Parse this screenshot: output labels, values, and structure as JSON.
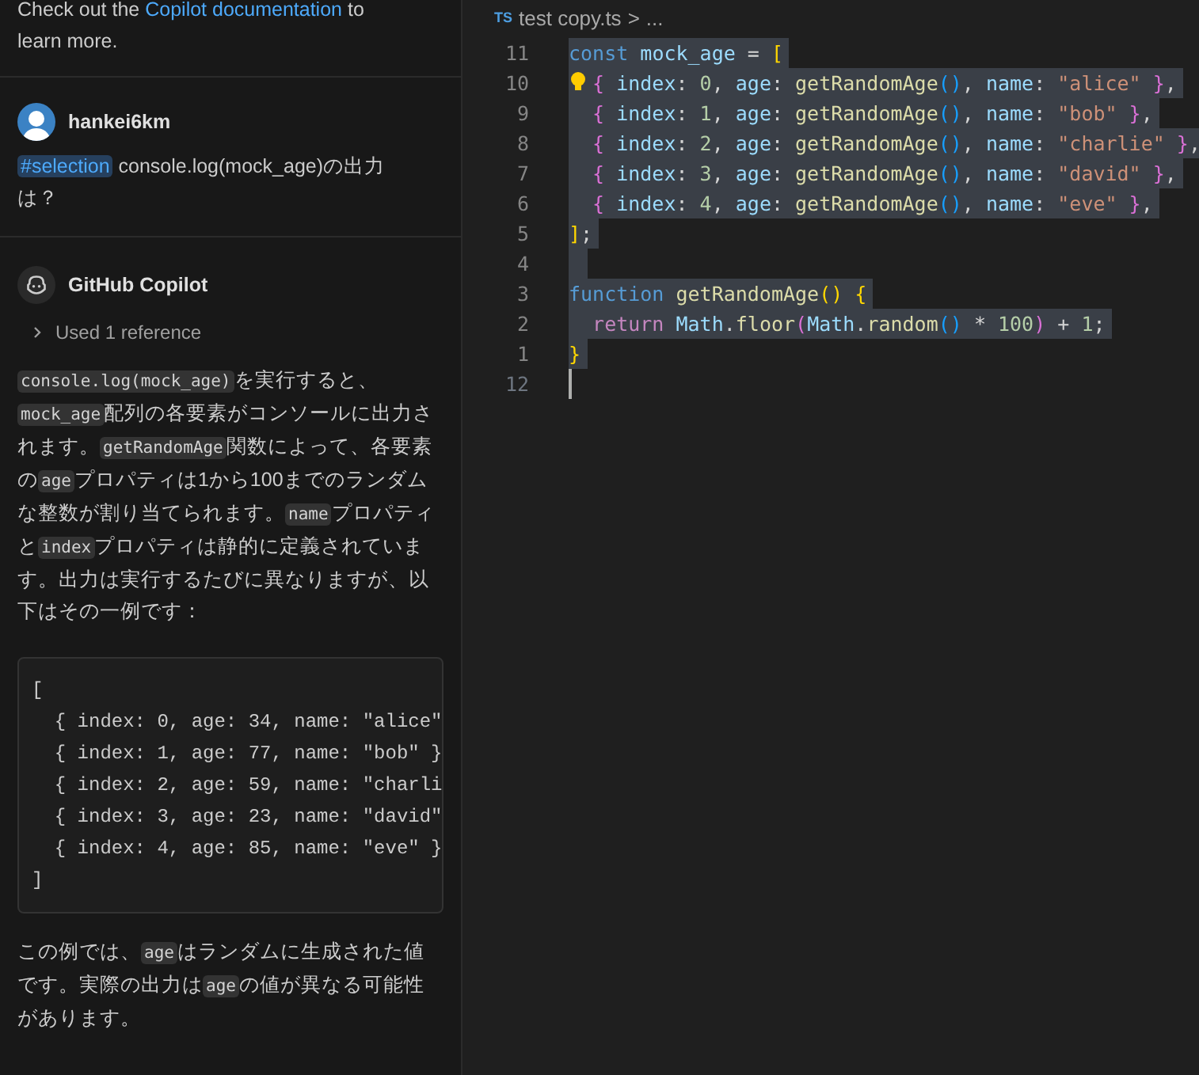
{
  "chat": {
    "intro": [
      {
        "kind": "text",
        "text": "Check out the "
      },
      {
        "kind": "link",
        "text": "Copilot documentation"
      },
      {
        "kind": "text",
        "text": " to learn more."
      }
    ],
    "question": {
      "user": "hankei6km",
      "tag": "#selection",
      "text": " console.log(mock_age)の出力は？"
    },
    "answer": {
      "author": "GitHub Copilot",
      "references": "Used 1 reference",
      "expanded": false,
      "paragraph_1": [
        {
          "kind": "code",
          "text": "console.log(mock_age)"
        },
        {
          "kind": "text",
          "text": "を実行すると、"
        },
        {
          "kind": "code",
          "text": "mock_age"
        },
        {
          "kind": "text",
          "text": "配列の各要素がコンソールに出力されます。"
        },
        {
          "kind": "code",
          "text": "getRandomAge"
        },
        {
          "kind": "text",
          "text": "関数によって、各要素の"
        },
        {
          "kind": "code",
          "text": "age"
        },
        {
          "kind": "text",
          "text": "プロパティは1から100までのランダムな整数が割り当てられます。"
        },
        {
          "kind": "code",
          "text": "name"
        },
        {
          "kind": "text",
          "text": "プロパティと"
        },
        {
          "kind": "code",
          "text": "index"
        },
        {
          "kind": "text",
          "text": "プロパティは静的に定義されています。出力は実行するたびに異なりますが、以下はその一例です："
        }
      ],
      "code_block": [
        "[",
        "  { index: 0, age: 34, name: \"alice\"",
        "  { index: 1, age: 77, name: \"bob\" }",
        "  { index: 2, age: 59, name: \"charli",
        "  { index: 3, age: 23, name: \"david\"",
        "  { index: 4, age: 85, name: \"eve\" }",
        "]"
      ],
      "paragraph_2": [
        {
          "kind": "text",
          "text": "この例では、"
        },
        {
          "kind": "code",
          "text": "age"
        },
        {
          "kind": "text",
          "text": "はランダムに生成された値です。実際の出力は"
        },
        {
          "kind": "code",
          "text": "age"
        },
        {
          "kind": "text",
          "text": "の値が異なる可能性があります。"
        }
      ]
    }
  },
  "editor": {
    "breadcrumb": {
      "icon": "TS",
      "file": "test copy.ts",
      "separator": ">",
      "rest": "..."
    },
    "lines": [
      {
        "number": "11",
        "selected": true,
        "current": false,
        "lightbulb": false,
        "tokens": [
          {
            "kind": "keyword",
            "text": "const"
          },
          {
            "kind": "variable",
            "text": " mock_age"
          },
          {
            "kind": "plain",
            "text": " = "
          },
          {
            "kind": "bracket1",
            "text": "["
          }
        ]
      },
      {
        "number": "10",
        "selected": true,
        "current": false,
        "lightbulb": true,
        "tokens": [
          {
            "kind": "bracket2",
            "text": "  {"
          },
          {
            "kind": "variable",
            "text": " index"
          },
          {
            "kind": "plain",
            "text": ": "
          },
          {
            "kind": "number",
            "text": "0"
          },
          {
            "kind": "plain",
            "text": ", "
          },
          {
            "kind": "variable",
            "text": "age"
          },
          {
            "kind": "plain",
            "text": ": "
          },
          {
            "kind": "function",
            "text": "getRandomAge"
          },
          {
            "kind": "bracket3",
            "text": "()"
          },
          {
            "kind": "plain",
            "text": ", "
          },
          {
            "kind": "variable",
            "text": "name"
          },
          {
            "kind": "plain",
            "text": ": "
          },
          {
            "kind": "string",
            "text": "\"alice\""
          },
          {
            "kind": "bracket2",
            "text": " }"
          },
          {
            "kind": "plain",
            "text": ","
          }
        ]
      },
      {
        "number": "9",
        "selected": true,
        "current": false,
        "lightbulb": false,
        "tokens": [
          {
            "kind": "bracket2",
            "text": "  {"
          },
          {
            "kind": "variable",
            "text": " index"
          },
          {
            "kind": "plain",
            "text": ": "
          },
          {
            "kind": "number",
            "text": "1"
          },
          {
            "kind": "plain",
            "text": ", "
          },
          {
            "kind": "variable",
            "text": "age"
          },
          {
            "kind": "plain",
            "text": ": "
          },
          {
            "kind": "function",
            "text": "getRandomAge"
          },
          {
            "kind": "bracket3",
            "text": "()"
          },
          {
            "kind": "plain",
            "text": ", "
          },
          {
            "kind": "variable",
            "text": "name"
          },
          {
            "kind": "plain",
            "text": ": "
          },
          {
            "kind": "string",
            "text": "\"bob\""
          },
          {
            "kind": "bracket2",
            "text": " }"
          },
          {
            "kind": "plain",
            "text": ","
          }
        ]
      },
      {
        "number": "8",
        "selected": true,
        "current": false,
        "lightbulb": false,
        "tokens": [
          {
            "kind": "bracket2",
            "text": "  {"
          },
          {
            "kind": "variable",
            "text": " index"
          },
          {
            "kind": "plain",
            "text": ": "
          },
          {
            "kind": "number",
            "text": "2"
          },
          {
            "kind": "plain",
            "text": ", "
          },
          {
            "kind": "variable",
            "text": "age"
          },
          {
            "kind": "plain",
            "text": ": "
          },
          {
            "kind": "function",
            "text": "getRandomAge"
          },
          {
            "kind": "bracket3",
            "text": "()"
          },
          {
            "kind": "plain",
            "text": ", "
          },
          {
            "kind": "variable",
            "text": "name"
          },
          {
            "kind": "plain",
            "text": ": "
          },
          {
            "kind": "string",
            "text": "\"charlie\""
          },
          {
            "kind": "bracket2",
            "text": " }"
          },
          {
            "kind": "plain",
            "text": ","
          }
        ]
      },
      {
        "number": "7",
        "selected": true,
        "current": false,
        "lightbulb": false,
        "tokens": [
          {
            "kind": "bracket2",
            "text": "  {"
          },
          {
            "kind": "variable",
            "text": " index"
          },
          {
            "kind": "plain",
            "text": ": "
          },
          {
            "kind": "number",
            "text": "3"
          },
          {
            "kind": "plain",
            "text": ", "
          },
          {
            "kind": "variable",
            "text": "age"
          },
          {
            "kind": "plain",
            "text": ": "
          },
          {
            "kind": "function",
            "text": "getRandomAge"
          },
          {
            "kind": "bracket3",
            "text": "()"
          },
          {
            "kind": "plain",
            "text": ", "
          },
          {
            "kind": "variable",
            "text": "name"
          },
          {
            "kind": "plain",
            "text": ": "
          },
          {
            "kind": "string",
            "text": "\"david\""
          },
          {
            "kind": "bracket2",
            "text": " }"
          },
          {
            "kind": "plain",
            "text": ","
          }
        ]
      },
      {
        "number": "6",
        "selected": true,
        "current": false,
        "lightbulb": false,
        "tokens": [
          {
            "kind": "bracket2",
            "text": "  {"
          },
          {
            "kind": "variable",
            "text": " index"
          },
          {
            "kind": "plain",
            "text": ": "
          },
          {
            "kind": "number",
            "text": "4"
          },
          {
            "kind": "plain",
            "text": ", "
          },
          {
            "kind": "variable",
            "text": "age"
          },
          {
            "kind": "plain",
            "text": ": "
          },
          {
            "kind": "function",
            "text": "getRandomAge"
          },
          {
            "kind": "bracket3",
            "text": "()"
          },
          {
            "kind": "plain",
            "text": ", "
          },
          {
            "kind": "variable",
            "text": "name"
          },
          {
            "kind": "plain",
            "text": ": "
          },
          {
            "kind": "string",
            "text": "\"eve\""
          },
          {
            "kind": "bracket2",
            "text": " }"
          },
          {
            "kind": "plain",
            "text": ","
          }
        ]
      },
      {
        "number": "5",
        "selected": true,
        "current": false,
        "lightbulb": false,
        "tokens": [
          {
            "kind": "bracket1",
            "text": "]"
          },
          {
            "kind": "plain",
            "text": ";"
          }
        ]
      },
      {
        "number": "4",
        "selected": true,
        "current": false,
        "lightbulb": false
      },
      {
        "number": "3",
        "selected": true,
        "current": false,
        "lightbulb": false,
        "tokens": [
          {
            "kind": "keyword",
            "text": "function"
          },
          {
            "kind": "function",
            "text": " getRandomAge"
          },
          {
            "kind": "bracket1",
            "text": "()"
          },
          {
            "kind": "bracket1",
            "text": " {"
          }
        ]
      },
      {
        "number": "2",
        "selected": true,
        "current": false,
        "lightbulb": false,
        "tokens": [
          {
            "kind": "control",
            "text": "  return"
          },
          {
            "kind": "variable",
            "text": " Math"
          },
          {
            "kind": "plain",
            "text": "."
          },
          {
            "kind": "function",
            "text": "floor"
          },
          {
            "kind": "bracket2",
            "text": "("
          },
          {
            "kind": "variable",
            "text": "Math"
          },
          {
            "kind": "plain",
            "text": "."
          },
          {
            "kind": "function",
            "text": "random"
          },
          {
            "kind": "bracket3",
            "text": "()"
          },
          {
            "kind": "plain",
            "text": " * "
          },
          {
            "kind": "number",
            "text": "100"
          },
          {
            "kind": "bracket2",
            "text": ")"
          },
          {
            "kind": "plain",
            "text": " + "
          },
          {
            "kind": "number",
            "text": "1"
          },
          {
            "kind": "plain",
            "text": ";"
          }
        ]
      },
      {
        "number": "1",
        "selected": true,
        "current": false,
        "lightbulb": false,
        "tokens": [
          {
            "kind": "bracket1",
            "text": "}"
          }
        ]
      },
      {
        "number": "12",
        "selected": false,
        "current": true,
        "lightbulb": false
      }
    ]
  }
}
